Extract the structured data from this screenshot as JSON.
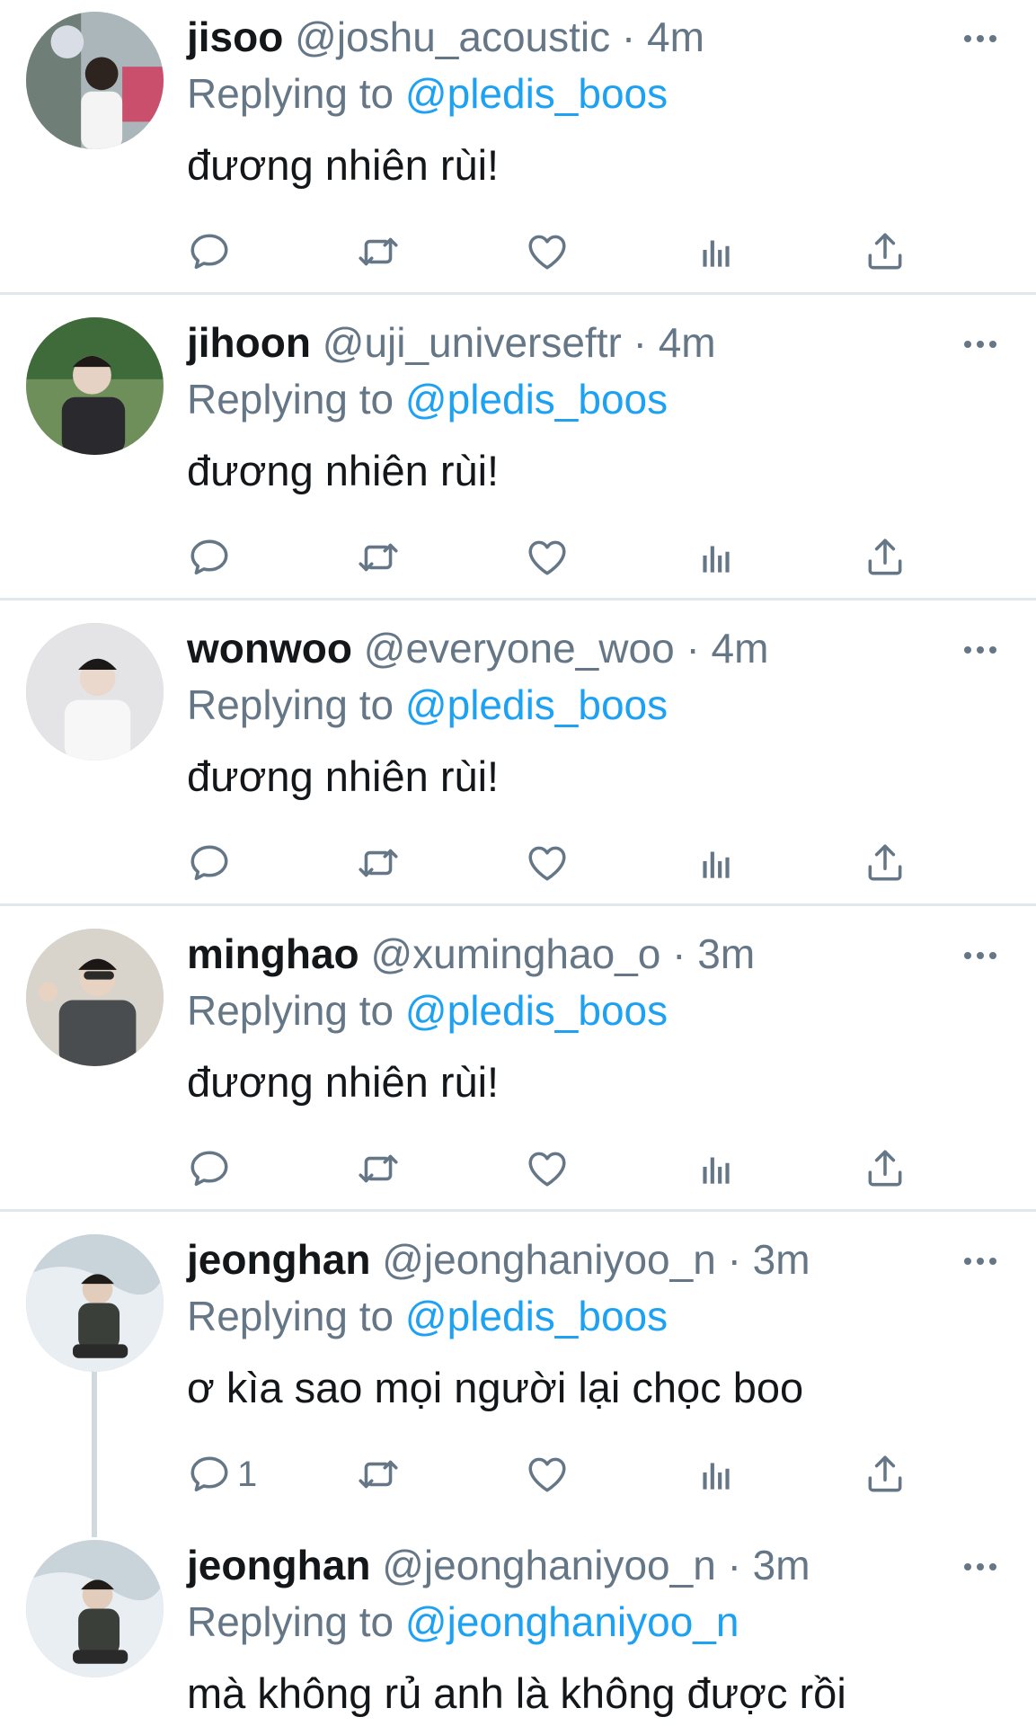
{
  "icons": {
    "reply": "reply-icon",
    "retweet": "retweet-icon",
    "like": "heart-icon",
    "analytics": "analytics-icon",
    "share": "share-icon",
    "more": "more-icon"
  },
  "colors": {
    "link": "#1da1f2",
    "secondary": "#657786",
    "text": "#14171a",
    "divider": "#e1e8ed"
  },
  "tweets": [
    {
      "name": "jisoo",
      "handle": "@joshu_acoustic",
      "time": "· 4m",
      "replying_prefix": "Replying to",
      "replying_to": "@pledis_boos",
      "text": "đương nhiên rùi!",
      "reply_count": ""
    },
    {
      "name": "jihoon",
      "handle": "@uji_universeftr",
      "time": "· 4m",
      "replying_prefix": "Replying to",
      "replying_to": "@pledis_boos",
      "text": "đương nhiên rùi!",
      "reply_count": ""
    },
    {
      "name": "wonwoo",
      "handle": "@everyone_woo",
      "time": "· 4m",
      "replying_prefix": "Replying to",
      "replying_to": "@pledis_boos",
      "text": "đương nhiên rùi!",
      "reply_count": ""
    },
    {
      "name": "minghao",
      "handle": "@xuminghao_o",
      "time": "· 3m",
      "replying_prefix": "Replying to",
      "replying_to": "@pledis_boos",
      "text": "đương nhiên rùi!",
      "reply_count": ""
    },
    {
      "name": "jeonghan",
      "handle": "@jeonghaniyoo_n",
      "time": "· 3m",
      "replying_prefix": "Replying to",
      "replying_to": "@pledis_boos",
      "text": "ơ kìa sao mọi người lại chọc boo",
      "reply_count": "1"
    },
    {
      "name": "jeonghan",
      "handle": "@jeonghaniyoo_n",
      "time": "· 3m",
      "replying_prefix": "Replying to",
      "replying_to": "@jeonghaniyoo_n",
      "text": "mà không rủ anh là không được rồi",
      "reply_count": ""
    }
  ]
}
